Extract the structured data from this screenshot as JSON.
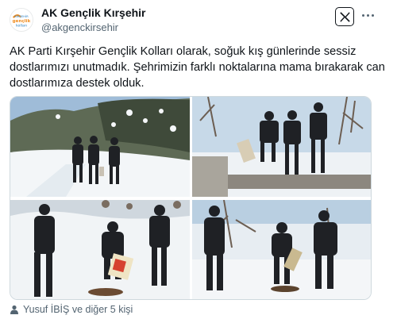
{
  "account": {
    "display_name": "AK Gençlik Kırşehir",
    "handle": "@akgenckirsehir",
    "avatar_text_top": "KIRŞEHİR",
    "avatar_text_mid": "gençlik",
    "avatar_text_bot": "kolları"
  },
  "post": {
    "text": "AK Parti Kırşehir Gençlik Kolları olarak, soğuk kış günlerinde sessiz dostlarımızı unutmadık. Şehrimizin farklı noktalarına mama bırakarak can dostlarımıza destek olduk."
  },
  "media": {
    "photos": [
      {
        "alt": "photo-1"
      },
      {
        "alt": "photo-2"
      },
      {
        "alt": "photo-3"
      },
      {
        "alt": "photo-4"
      }
    ]
  },
  "footer": {
    "tagged_text": "Yusuf İBİŞ ve diğer 5 kişi"
  },
  "icons": {
    "brand": "x-logo-icon",
    "more": "more-dots-icon",
    "tagged": "person-icon"
  },
  "colors": {
    "text": "#0f1419",
    "secondary": "#536471",
    "border": "#cfd9de",
    "brand_orange": "#f08c1e",
    "brand_blue": "#2a7fc1"
  }
}
